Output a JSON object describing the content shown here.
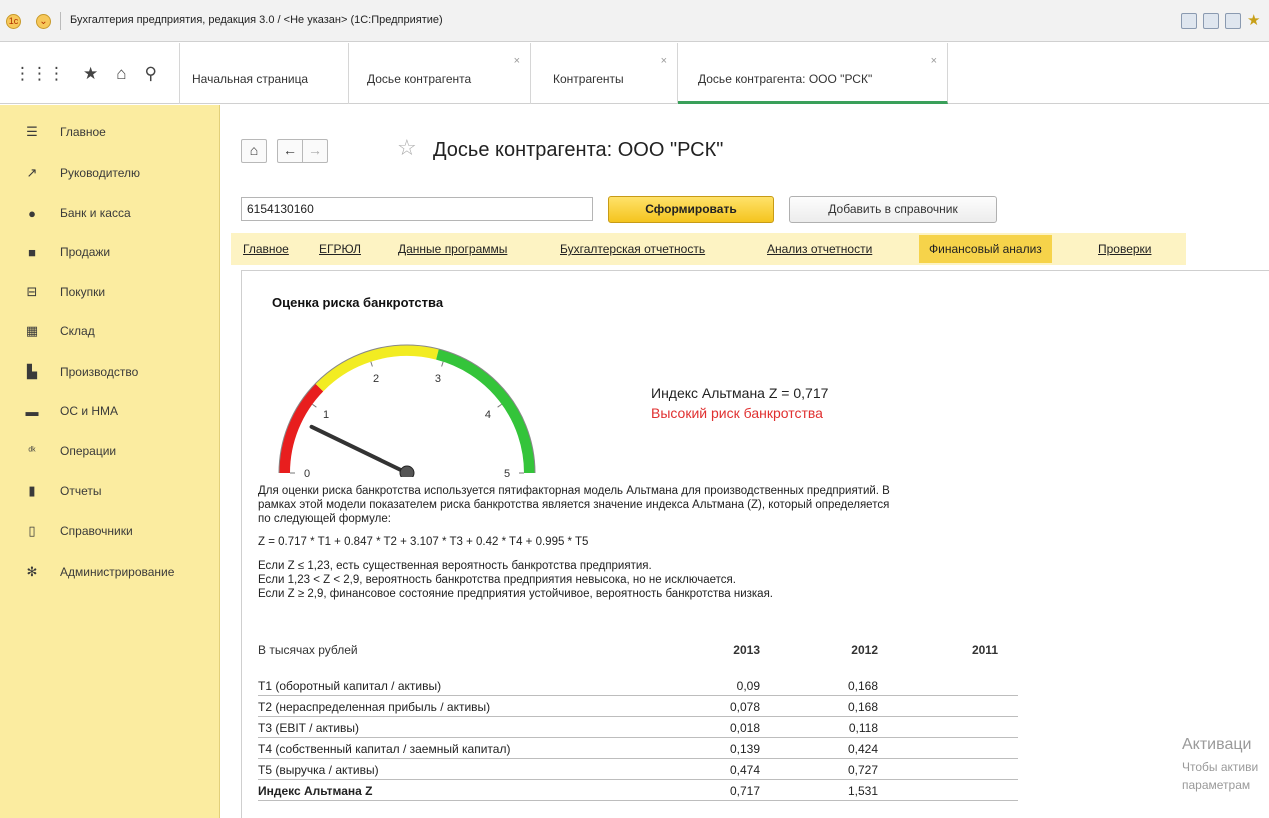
{
  "window": {
    "title": "Бухгалтерия предприятия, редакция 3.0 / <Не указан>  (1С:Предприятие)",
    "logo_glyph": "1c"
  },
  "tabs": [
    {
      "label": "Начальная страница",
      "closable": false
    },
    {
      "label": "Досье контрагента",
      "closable": true
    },
    {
      "label": "Контрагенты",
      "closable": true
    },
    {
      "label": "Досье контрагента: ООО \"РСК\"",
      "closable": true,
      "active": true
    }
  ],
  "close_glyph": "×",
  "sidebar": {
    "items": [
      {
        "label": "Главное",
        "icon": "menu-icon"
      },
      {
        "label": "Руководителю",
        "icon": "trend-icon"
      },
      {
        "label": "Банк и касса",
        "icon": "coin-icon"
      },
      {
        "label": "Продажи",
        "icon": "bag-icon"
      },
      {
        "label": "Покупки",
        "icon": "cart-icon"
      },
      {
        "label": "Склад",
        "icon": "warehouse-icon"
      },
      {
        "label": "Производство",
        "icon": "factory-icon"
      },
      {
        "label": "ОС и НМА",
        "icon": "truck-icon"
      },
      {
        "label": "Операции",
        "icon": "dt-kt-icon"
      },
      {
        "label": "Отчеты",
        "icon": "bar-chart-icon"
      },
      {
        "label": "Справочники",
        "icon": "books-icon"
      },
      {
        "label": "Администрирование",
        "icon": "gear-icon"
      }
    ]
  },
  "page": {
    "title": "Досье контрагента: ООО \"РСК\"",
    "inn_value": "6154130160",
    "generate_button": "Сформировать",
    "add_button": "Добавить в справочник"
  },
  "sections": [
    {
      "label": "Главное"
    },
    {
      "label": "ЕГРЮЛ"
    },
    {
      "label": "Данные программы"
    },
    {
      "label": "Бухгалтерская отчетность"
    },
    {
      "label": "Анализ отчетности"
    },
    {
      "label": "Финансовый анализ",
      "active": true
    },
    {
      "label": "Проверки"
    }
  ],
  "report": {
    "title": "Оценка риска банкротства",
    "gauge": {
      "min": 0,
      "max": 5,
      "value": 0.717,
      "ticks": [
        "0",
        "1",
        "2",
        "3",
        "4",
        "5"
      ],
      "zones": [
        {
          "from": 0,
          "to": 1.23,
          "color": "#e81e1e"
        },
        {
          "from": 1.23,
          "to": 2.9,
          "color": "#f2ec22"
        },
        {
          "from": 2.9,
          "to": 5,
          "color": "#34c43a"
        }
      ]
    },
    "z_index_text": "Индекс Альтмана Z = 0,717",
    "risk_text": "Высокий риск банкротства",
    "risk_color": "#e03030",
    "description": [
      "Для оценки риска банкротства используется пятифакторная модель Альтмана для производственных предприятий. В",
      "рамках этой модели показателем риска банкротства является значение индекса Альтмана (Z), который определяется",
      "по следующей формуле:"
    ],
    "formula": "Z = 0.717 * T1 + 0.847 * T2 + 3.107 * T3 + 0.42 * T4 + 0.995 * T5",
    "rules": [
      "Если Z ≤ 1,23, есть существенная вероятность банкротства предприятия.",
      "Если 1,23 < Z < 2,9, вероятность банкротства предприятия невысока, но не исключается.",
      "Если Z ≥ 2,9, финансовое состояние предприятия устойчивое, вероятность банкротства низкая."
    ],
    "table": {
      "header_label": "В тысячах рублей",
      "years": [
        "2013",
        "2012",
        "2011"
      ],
      "rows": [
        {
          "name": "T1 (оборотный капитал / активы)",
          "values": [
            "0,09",
            "0,168",
            ""
          ]
        },
        {
          "name": "T2 (нераспределенная прибыль / активы)",
          "values": [
            "0,078",
            "0,168",
            ""
          ]
        },
        {
          "name": "T3 (EBIT / активы)",
          "values": [
            "0,018",
            "0,118",
            ""
          ]
        },
        {
          "name": "T4 (собственный капитал / заемный капитал)",
          "values": [
            "0,139",
            "0,424",
            ""
          ]
        },
        {
          "name": "T5 (выручка / активы)",
          "values": [
            "0,474",
            "0,727",
            ""
          ]
        },
        {
          "name": "Индекс Альтмана Z",
          "values": [
            "0,717",
            "1,531",
            ""
          ],
          "bold": true
        }
      ]
    }
  },
  "watermark": {
    "line1": "Активаци",
    "line2": "Чтобы активи",
    "line3": "параметрам"
  }
}
